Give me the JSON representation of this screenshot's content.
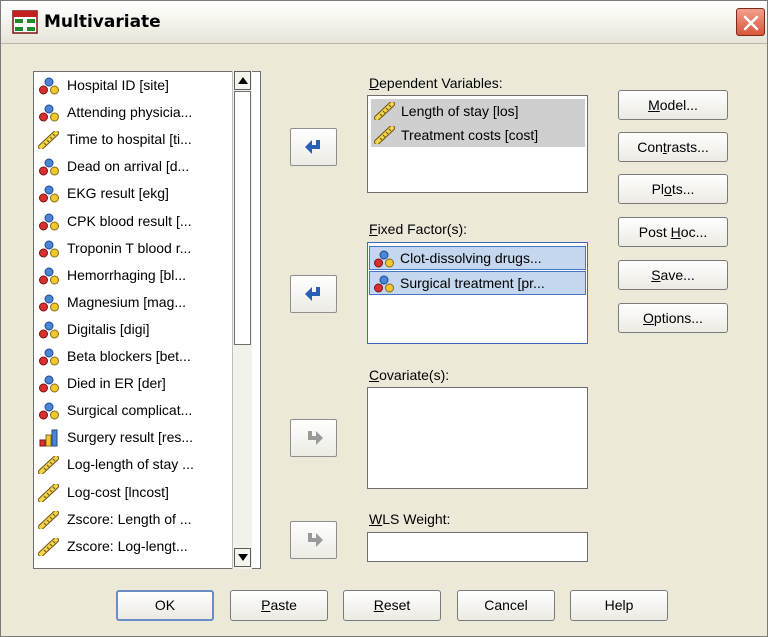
{
  "window": {
    "title": "Multivariate"
  },
  "variables": [
    {
      "label": "Hospital ID [site]",
      "icon": "nominal-icon"
    },
    {
      "label": "Attending physicia...",
      "icon": "nominal-icon"
    },
    {
      "label": "Time to hospital [ti...",
      "icon": "scale-icon"
    },
    {
      "label": "Dead on arrival [d...",
      "icon": "nominal-icon"
    },
    {
      "label": "EKG result [ekg]",
      "icon": "nominal-icon"
    },
    {
      "label": "CPK blood result [...",
      "icon": "nominal-icon"
    },
    {
      "label": "Troponin T blood r...",
      "icon": "nominal-icon"
    },
    {
      "label": "Hemorrhaging [bl...",
      "icon": "nominal-icon"
    },
    {
      "label": "Magnesium [mag...",
      "icon": "nominal-icon"
    },
    {
      "label": "Digitalis [digi]",
      "icon": "nominal-icon"
    },
    {
      "label": "Beta blockers [bet...",
      "icon": "nominal-icon"
    },
    {
      "label": "Died in ER [der]",
      "icon": "nominal-icon"
    },
    {
      "label": "Surgical complicat...",
      "icon": "nominal-icon"
    },
    {
      "label": "Surgery result [res...",
      "icon": "ordinal-icon"
    },
    {
      "label": "Log-length of stay ...",
      "icon": "scale-icon"
    },
    {
      "label": "Log-cost [lncost]",
      "icon": "scale-icon"
    },
    {
      "label": "Zscore:  Length of ...",
      "icon": "scale-icon"
    },
    {
      "label": "Zscore:  Log-lengt...",
      "icon": "scale-icon"
    }
  ],
  "dependent": {
    "label_key": "D",
    "label_rest": "ependent Variables:",
    "items": [
      "Length of stay [los]",
      "Treatment costs [cost]"
    ]
  },
  "fixed": {
    "label_key": "F",
    "label_rest": "ixed Factor(s):",
    "items": [
      "Clot-dissolving drugs...",
      "Surgical treatment [pr..."
    ]
  },
  "covariate": {
    "label_key": "C",
    "label_rest": "ovariate(s):"
  },
  "wls": {
    "label_key": "W",
    "label_rest": "LS Weight:",
    "value": ""
  },
  "side_buttons": [
    {
      "pre": "",
      "key": "M",
      "post": "odel..."
    },
    {
      "pre": "Con",
      "key": "t",
      "post": "rasts..."
    },
    {
      "pre": "Pl",
      "key": "o",
      "post": "ts..."
    },
    {
      "pre": "Post ",
      "key": "H",
      "post": "oc..."
    },
    {
      "pre": "",
      "key": "S",
      "post": "ave..."
    },
    {
      "pre": "",
      "key": "O",
      "post": "ptions..."
    }
  ],
  "bottom_buttons": [
    {
      "pre": "OK",
      "key": "",
      "post": ""
    },
    {
      "pre": "",
      "key": "P",
      "post": "aste"
    },
    {
      "pre": "",
      "key": "R",
      "post": "eset"
    },
    {
      "pre": "Cancel",
      "key": "",
      "post": ""
    },
    {
      "pre": "Help",
      "key": "",
      "post": ""
    }
  ],
  "colors": {
    "dialog_bg": "#ece9d8",
    "selected_row_bg": "#c4d7ee",
    "dependent_row_bg": "#cfcfcf",
    "arrow_blue": "#2a5fb8",
    "arrow_disabled": "#9a9a9a"
  }
}
